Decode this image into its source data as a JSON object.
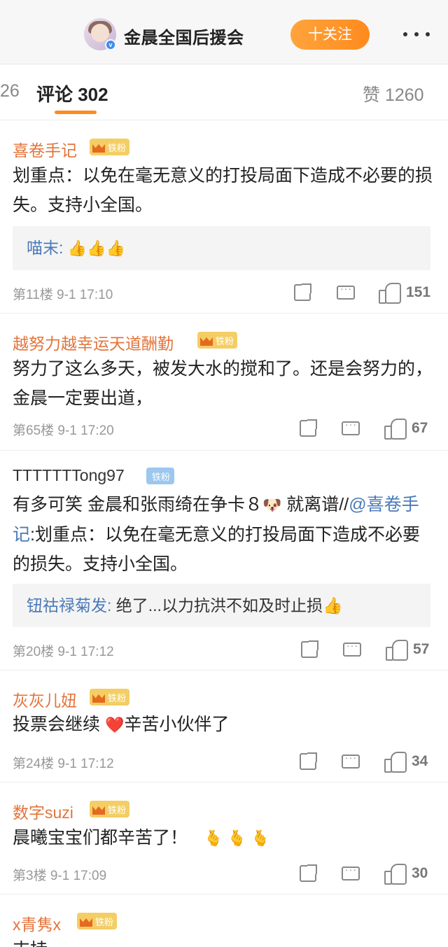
{
  "header": {
    "title": "金晨全国后援会",
    "follow_label": "十关注",
    "verify_mark": "v"
  },
  "tabs": {
    "prev_count": "26",
    "comments_label": "评论 302",
    "likes_label": "赞 1260"
  },
  "comments": [
    {
      "user": "喜卷手记",
      "badge": "铁粉",
      "text": "划重点：以免在毫无意义的打投局面下造成不必要的损失。支持小全国。",
      "reply": {
        "user": "喵末:",
        "text": "👍👍👍"
      },
      "meta": "第11楼  9-1 17:10",
      "likes": "151"
    },
    {
      "user": "越努力越幸运天道酬勤",
      "badge": "铁粉",
      "text": "努力了这么多天，被发大水的搅和了。还是会努力的，金晨一定要出道，",
      "meta": "第65楼  9-1 17:20",
      "likes": "67"
    },
    {
      "user": "TTTTTTTong97",
      "badge": "铁粉",
      "text_before": "有多可笑 金晨和张雨绮在争卡８",
      "emoji": "🐶",
      "text_mid": " 就离谱//",
      "mention": "@喜卷手记",
      "text_after": ":划重点：以免在毫无意义的打投局面下造成不必要的损失。支持小全国。",
      "reply": {
        "user": "钮祜禄菊发:",
        "text": " 绝了...以力抗洪不如及时止损👍"
      },
      "meta": "第20楼  9-1 17:12",
      "likes": "57"
    },
    {
      "user": "灰灰儿妞",
      "badge": "铁粉",
      "text_before": "投票会继续 ",
      "emoji": "❤️",
      "text_after": "辛苦小伙伴了",
      "meta": "第24楼  9-1 17:12",
      "likes": "34"
    },
    {
      "user": "数字suzi",
      "badge": "铁粉",
      "text": "晨曦宝宝们都辛苦了！",
      "emoji": "🫰 🫰 🫰",
      "meta": "第3楼  9-1 17:09",
      "likes": "30"
    },
    {
      "user": "x青隽x",
      "badge": "铁粉",
      "text": "支持"
    }
  ]
}
